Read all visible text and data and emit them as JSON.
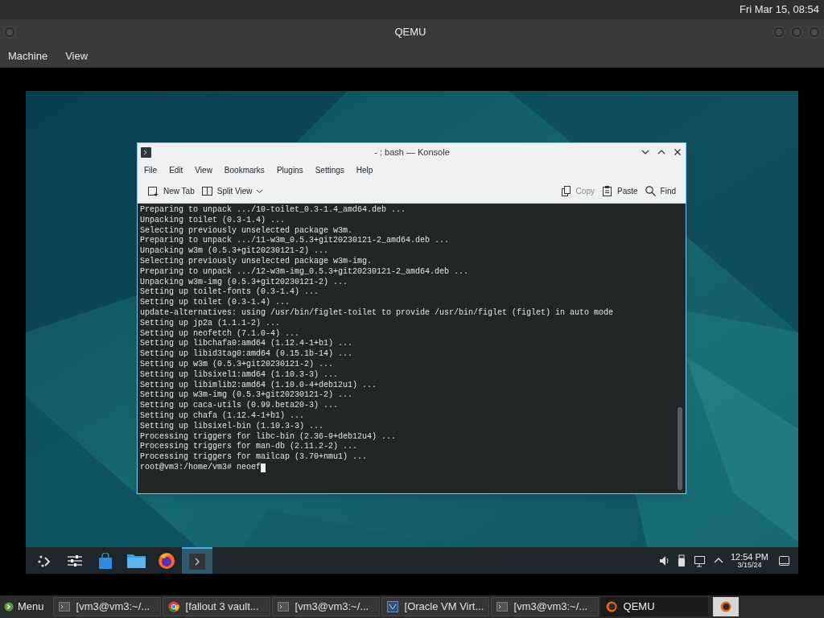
{
  "top_bar": {
    "clock": "Fri Mar 15, 08:54"
  },
  "qemu_window": {
    "title": "QEMU",
    "menu": [
      "Machine",
      "View"
    ]
  },
  "guest": {
    "konsole": {
      "title": "- : bash — Konsole",
      "menu": [
        "File",
        "Edit",
        "View",
        "Bookmarks",
        "Plugins",
        "Settings",
        "Help"
      ],
      "toolbar_left": [
        {
          "kind": "new-tab",
          "label": "New Tab",
          "disabled": false
        },
        {
          "kind": "split-view",
          "label": "Split View",
          "disabled": false
        }
      ],
      "toolbar_right": [
        {
          "kind": "copy",
          "label": "Copy",
          "disabled": true
        },
        {
          "kind": "paste",
          "label": "Paste",
          "disabled": false
        },
        {
          "kind": "find",
          "label": "Find",
          "disabled": false
        }
      ],
      "lines": [
        "Preparing to unpack .../10-toilet_0.3-1.4_amd64.deb ...",
        "Unpacking toilet (0.3-1.4) ...",
        "Selecting previously unselected package w3m.",
        "Preparing to unpack .../11-w3m_0.5.3+git20230121-2_amd64.deb ...",
        "Unpacking w3m (0.5.3+git20230121-2) ...",
        "Selecting previously unselected package w3m-img.",
        "Preparing to unpack .../12-w3m-img_0.5.3+git20230121-2_amd64.deb ...",
        "Unpacking w3m-img (0.5.3+git20230121-2) ...",
        "Setting up toilet-fonts (0.3-1.4) ...",
        "Setting up toilet (0.3-1.4) ...",
        "update-alternatives: using /usr/bin/figlet-toilet to provide /usr/bin/figlet (figlet) in auto mode",
        "Setting up jp2a (1.1.1-2) ...",
        "Setting up neofetch (7.1.0-4) ...",
        "Setting up libchafa0:amd64 (1.12.4-1+b1) ...",
        "Setting up libid3tag0:amd64 (0.15.1b-14) ...",
        "Setting up w3m (0.5.3+git20230121-2) ...",
        "Setting up libsixel1:amd64 (1.10.3-3) ...",
        "Setting up libimlib2:amd64 (1.10.0-4+deb12u1) ...",
        "Setting up w3m-img (0.5.3+git20230121-2) ...",
        "Setting up caca-utils (0.99.beta20-3) ...",
        "Setting up chafa (1.12.4-1+b1) ...",
        "Setting up libsixel-bin (1.10.3-3) ...",
        "Processing triggers for libc-bin (2.36-9+deb12u4) ...",
        "Processing triggers for man-db (2.11.2-2) ...",
        "Processing triggers for mailcap (3.70+nmu1) ..."
      ],
      "prompt": "root@vm3:/home/vm3# neoef"
    },
    "panel": {
      "launchers": [
        {
          "kind": "launcher",
          "selected": false
        },
        {
          "kind": "settings",
          "selected": false
        },
        {
          "kind": "store",
          "selected": false
        },
        {
          "kind": "folder",
          "selected": false
        },
        {
          "kind": "browser",
          "selected": false
        },
        {
          "kind": "terminal",
          "selected": true
        }
      ],
      "tray": [
        {
          "kind": "volume"
        },
        {
          "kind": "usb"
        },
        {
          "kind": "network"
        },
        {
          "kind": "chevron"
        }
      ],
      "time": "12:54 PM",
      "date": "3/15/24"
    }
  },
  "taskbar": {
    "menu": "Menu",
    "tasks": [
      {
        "kind": "terminal",
        "label": "[vm3@vm3:~/...",
        "selected": false
      },
      {
        "kind": "browser",
        "label": "[fallout 3 vault...",
        "selected": false
      },
      {
        "kind": "terminal",
        "label": "[vm3@vm3:~/...",
        "selected": false
      },
      {
        "kind": "vbox",
        "label": "[Oracle VM Virt...",
        "selected": false
      },
      {
        "kind": "terminal",
        "label": "[vm3@vm3:~/...",
        "selected": false
      },
      {
        "kind": "qemu",
        "label": "QEMU",
        "selected": true
      }
    ]
  }
}
